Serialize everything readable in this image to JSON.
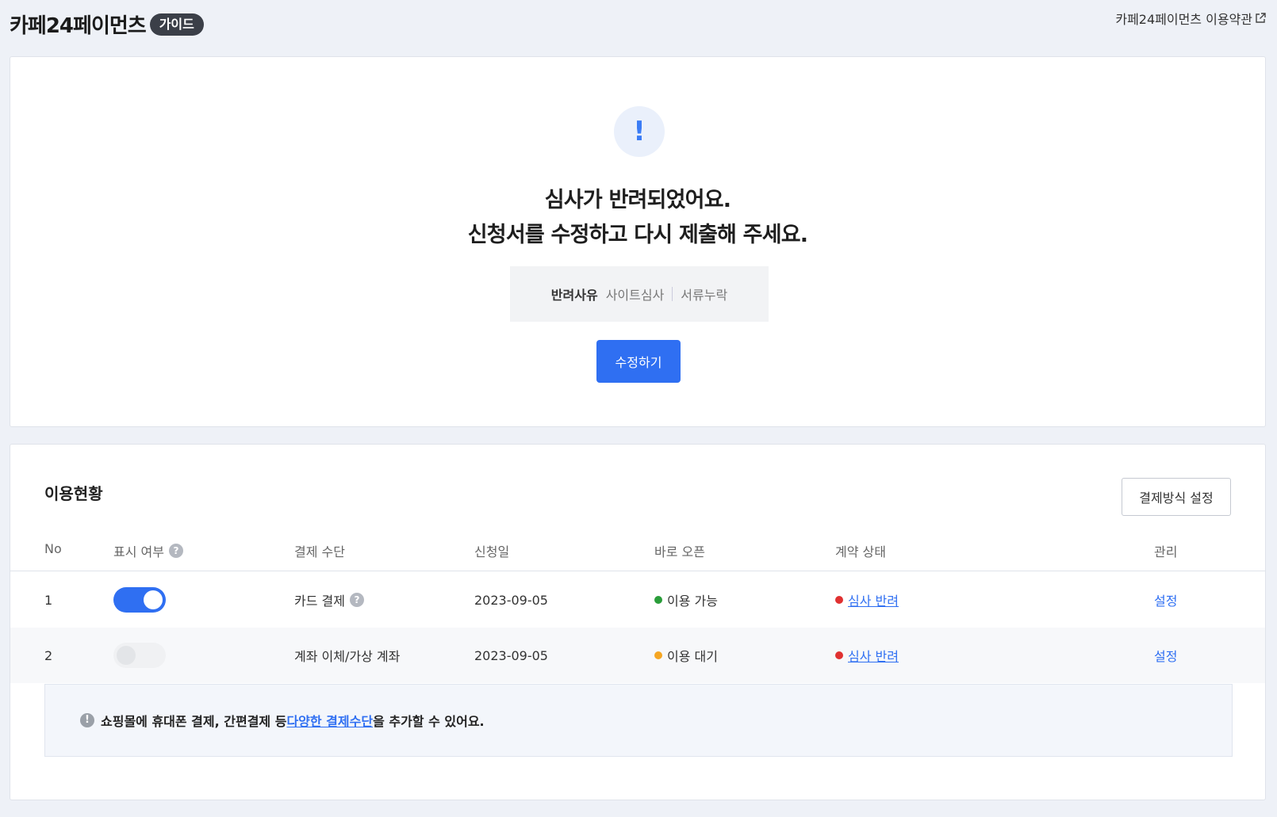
{
  "header": {
    "brand_title": "카페24페이먼츠",
    "guide_badge": "가이드",
    "terms_link": "카페24페이먼츠 이용약관"
  },
  "rejection": {
    "title_line1": "심사가 반려되었어요.",
    "title_line2": "신청서를 수정하고 다시 제출해 주세요.",
    "reason_label": "반려사유",
    "reasons": [
      "사이트심사",
      "서류누락"
    ],
    "edit_button": "수정하기",
    "alert_glyph": "!"
  },
  "status": {
    "title": "이용현황",
    "method_button": "결제방식 설정",
    "columns": {
      "no": "No",
      "display": "표시 여부",
      "method": "결제 수단",
      "date": "신청일",
      "open": "바로 오픈",
      "contract": "계약 상태",
      "manage": "관리"
    },
    "rows": [
      {
        "no": "1",
        "display_on": true,
        "method": "카드 결제",
        "date": "2023-09-05",
        "open": "이용 가능",
        "open_color": "#2a9d3a",
        "contract": "심사 반려",
        "contract_color": "#e03131",
        "manage": "설정"
      },
      {
        "no": "2",
        "display_on": false,
        "method": "계좌 이체/가상 계좌",
        "date": "2023-09-05",
        "open": "이용 대기",
        "open_color": "#f5a623",
        "contract": "심사 반려",
        "contract_color": "#e03131",
        "manage": "설정"
      }
    ]
  },
  "info": {
    "text_before": "쇼핑몰에 휴대폰 결제, 간편결제 등 ",
    "link_text": "다양한 결제수단",
    "text_after": "을 추가할 수 있어요."
  },
  "colors": {
    "accent": "#2f6ff2",
    "background": "#eef1f7"
  }
}
